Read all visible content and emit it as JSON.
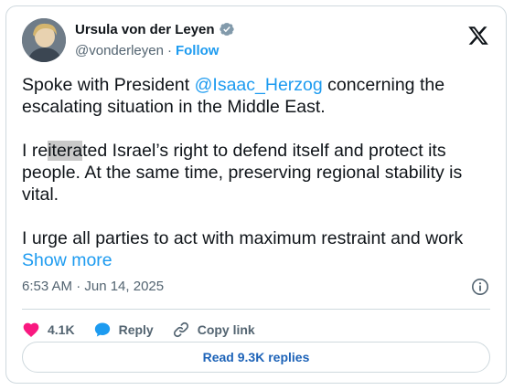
{
  "author": {
    "name": "Ursula von der Leyen",
    "handle": "@vonderleyen",
    "separator": "·",
    "follow_label": "Follow",
    "verified_icon": "verified-badge-icon"
  },
  "tweet": {
    "p1_before": "Spoke with President ",
    "p1_mention": "@Isaac_Herzog",
    "p1_after": " concerning the escalating situation in the Middle East.",
    "p2_before": "I re",
    "p2_highlight": "itera",
    "p2_after": "ted Israel’s right to defend itself and protect its people. At the same time, preserving regional stability is vital.",
    "p3": "I urge all parties to act with maximum restraint and work ",
    "show_more": "Show more"
  },
  "meta": {
    "timestamp": "6:53 AM · Jun 14, 2025"
  },
  "actions": {
    "like_count": "4.1K",
    "reply_label": "Reply",
    "copy_link_label": "Copy link"
  },
  "replies_button": "Read 9.3K replies",
  "colors": {
    "accent": "#1d9bf0",
    "like": "#f91880",
    "reply": "#1d9bf0",
    "border": "#cfd9de",
    "muted": "#536471",
    "verified": "#829aab"
  }
}
